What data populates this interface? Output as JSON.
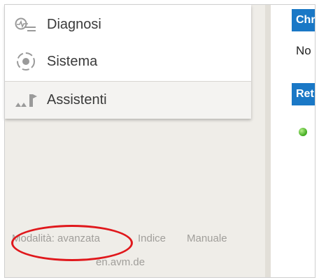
{
  "menu": {
    "items": [
      {
        "label": "Diagnosi",
        "icon": "diagnosis-icon"
      },
      {
        "label": "Sistema",
        "icon": "system-icon"
      },
      {
        "label": "Assistenti",
        "icon": "wizard-icon"
      }
    ]
  },
  "footer": {
    "mode": "Modalità: avanzata",
    "indice": "Indice",
    "manuale": "Manuale",
    "avm": "en.avm.de"
  },
  "right_panel": {
    "header_1": "Chr",
    "text_1": "No",
    "header_2": "Ret",
    "status_led_color": "#3da81c"
  },
  "colors": {
    "accent": "#1a78c6",
    "highlight_circle": "#e0181c"
  }
}
